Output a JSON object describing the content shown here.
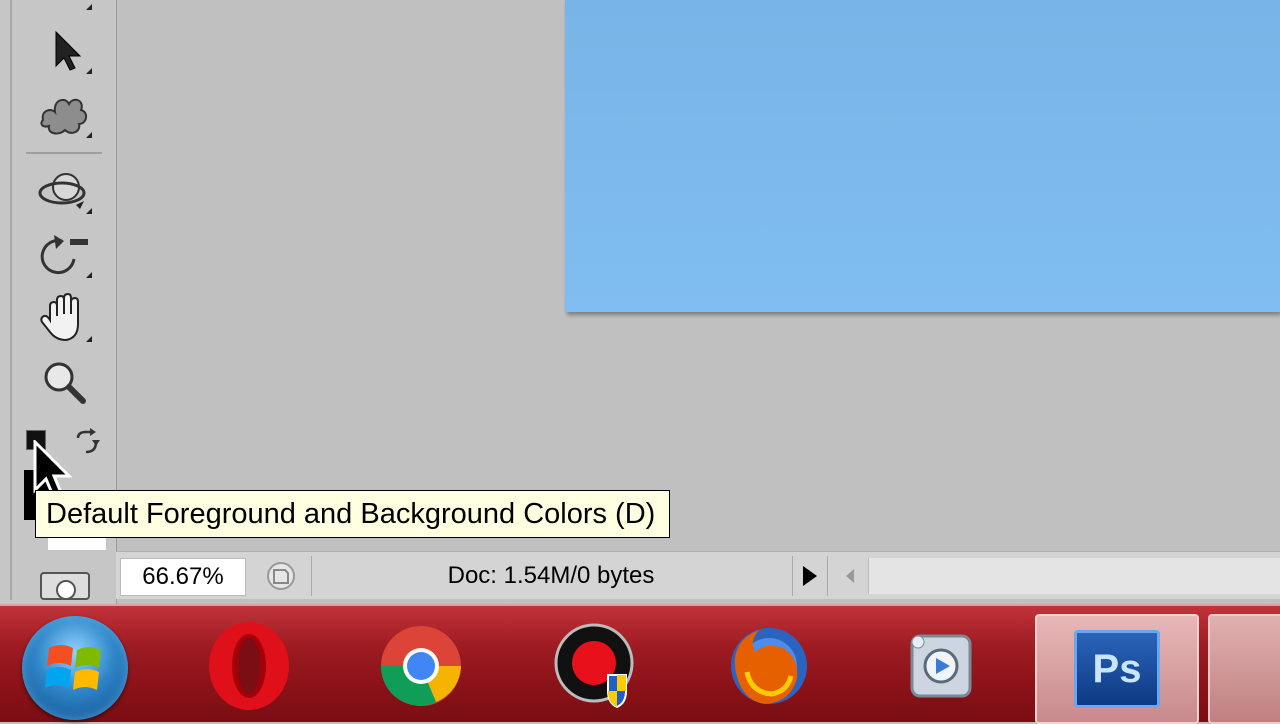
{
  "tooltip": {
    "text": "Default Foreground and Background Colors (D)"
  },
  "statusbar": {
    "zoom": "66.67%",
    "doc_info": "Doc: 1.54M/0 bytes"
  },
  "tools": [
    {
      "name": "move-tool",
      "icon": "arrow-icon"
    },
    {
      "name": "3d-object-tool",
      "icon": "3d-rotate-icon"
    },
    {
      "name": "3d-orbit-tool",
      "icon": "orbit-icon"
    },
    {
      "name": "rotate-view-tool",
      "icon": "rotate-view-icon"
    },
    {
      "name": "hand-tool",
      "icon": "hand-icon"
    },
    {
      "name": "zoom-tool",
      "icon": "magnifier-icon"
    }
  ],
  "taskbar": {
    "apps": [
      "Start",
      "Opera",
      "Google Chrome",
      "Screen Recorder",
      "Firefox",
      "Media Tool",
      "Photoshop"
    ],
    "ps_label": "Ps"
  },
  "colors": {
    "canvas_top": "#79b4e7",
    "canvas_bottom": "#80bdf0",
    "taskbar": "#9e1b22",
    "tooltip_bg": "#ffffe1"
  }
}
